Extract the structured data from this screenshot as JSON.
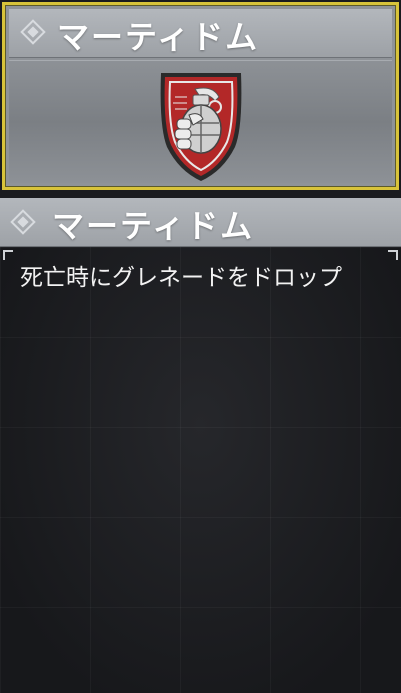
{
  "card": {
    "title": "マーティドム",
    "icon": "grenade-shield-icon",
    "selected": true
  },
  "detail": {
    "title": "マーティドム",
    "description": "死亡時にグレネードをドロップ"
  },
  "colors": {
    "selection_border": "#d8c33a",
    "header": "#a9adb2",
    "panel": "#1c1d20",
    "emblem_red": "#b32828"
  }
}
